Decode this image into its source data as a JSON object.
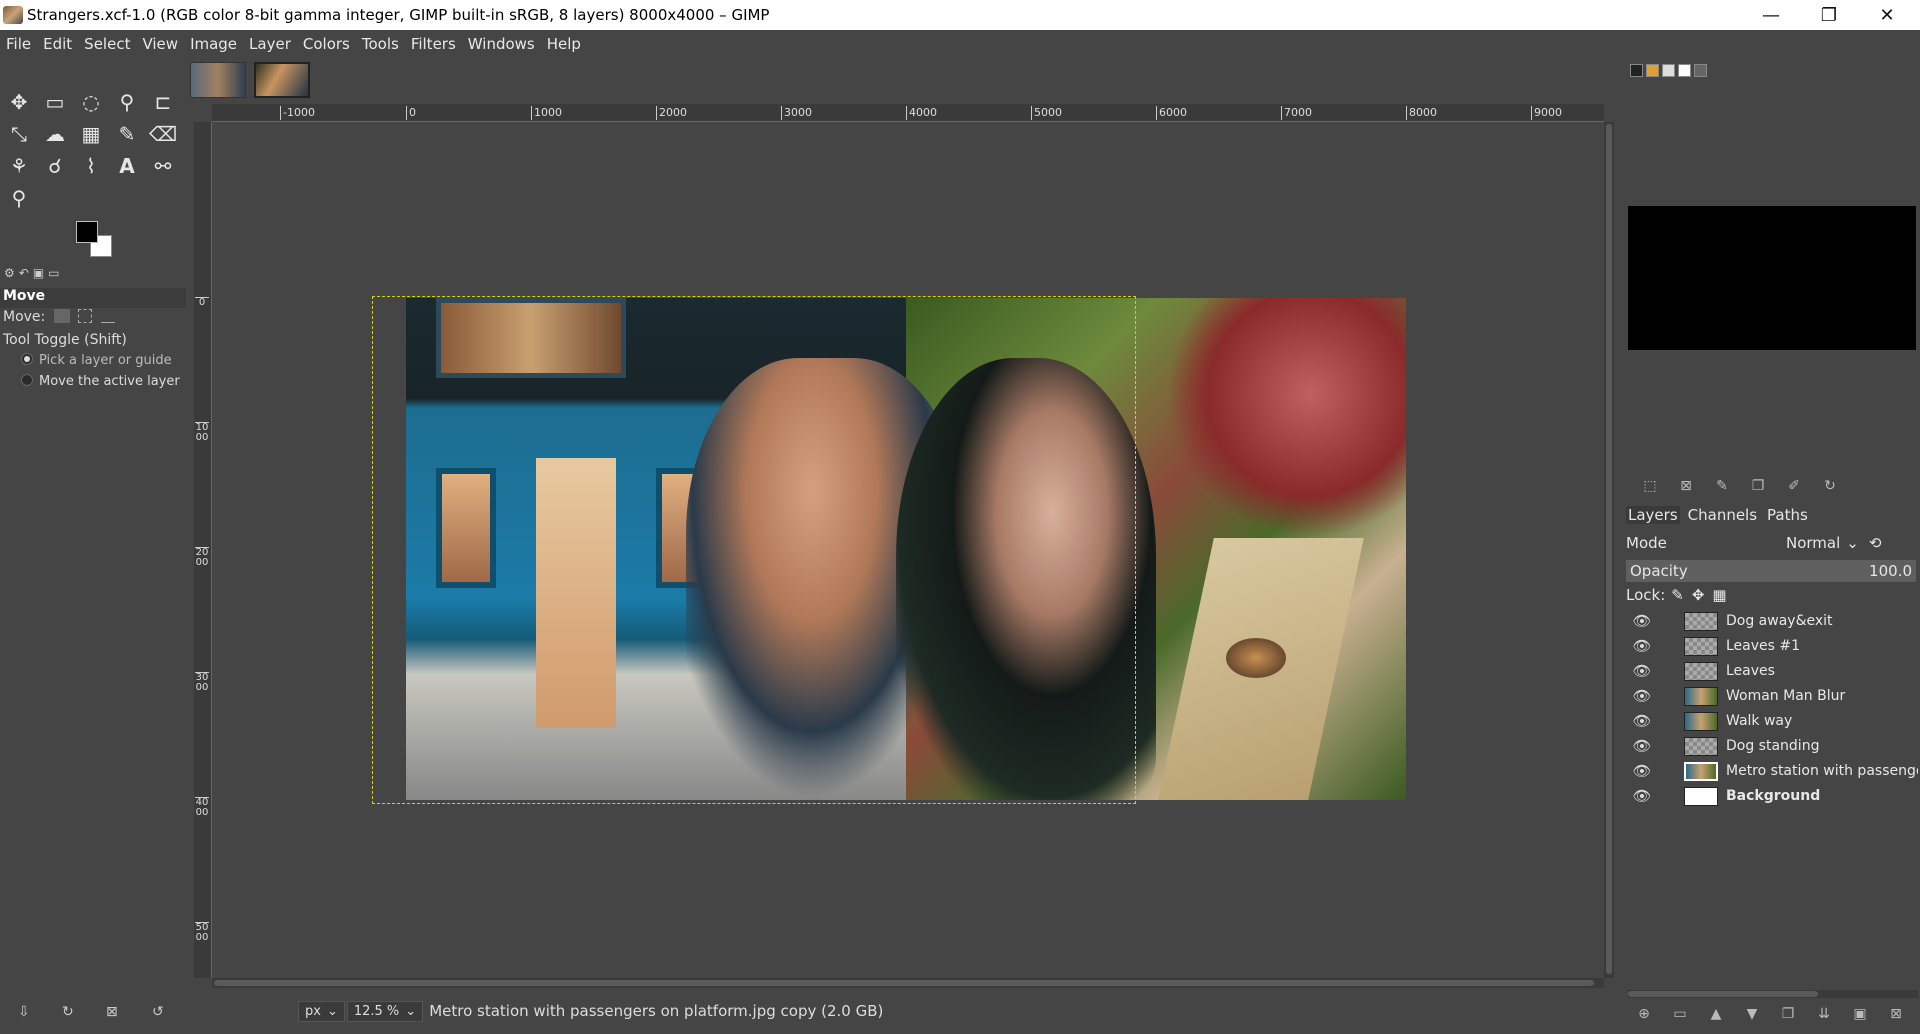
{
  "window": {
    "title": "Strangers.xcf-1.0 (RGB color 8-bit gamma integer, GIMP built-in sRGB, 8 layers) 8000x4000 – GIMP",
    "minimize_glyph": "—",
    "restore_glyph": "❐",
    "close_glyph": "✕"
  },
  "menu": [
    "File",
    "Edit",
    "Select",
    "View",
    "Image",
    "Layer",
    "Colors",
    "Tools",
    "Filters",
    "Windows",
    "Help"
  ],
  "toolbox": {
    "tools": [
      {
        "name": "move-tool",
        "glyph": "✥"
      },
      {
        "name": "rect-select-tool",
        "glyph": "▭"
      },
      {
        "name": "free-select-tool",
        "glyph": "◌"
      },
      {
        "name": "fuzzy-select-tool",
        "glyph": "⚲"
      },
      {
        "name": "crop-tool",
        "glyph": "⊏"
      },
      {
        "name": "unified-transform-tool",
        "glyph": "⤡"
      },
      {
        "name": "warp-transform-tool",
        "glyph": "☁"
      },
      {
        "name": "gradient-tool",
        "glyph": "▦"
      },
      {
        "name": "paintbrush-tool",
        "glyph": "✎"
      },
      {
        "name": "eraser-tool",
        "glyph": "⌫"
      },
      {
        "name": "clone-tool",
        "glyph": "⚘"
      },
      {
        "name": "smudge-tool",
        "glyph": "☌"
      },
      {
        "name": "paths-tool",
        "glyph": "⌇"
      },
      {
        "name": "text-tool",
        "glyph": "A"
      },
      {
        "name": "color-picker-tool",
        "glyph": "⚯"
      },
      {
        "name": "zoom-tool",
        "glyph": "⚲"
      }
    ],
    "tab_glyphs": [
      "⚙",
      "↶",
      "▣",
      "▭"
    ],
    "options": {
      "title": "Move",
      "move_label": "Move:",
      "tool_toggle": "Tool Toggle  (Shift)",
      "radio_pick": "Pick a layer or guide",
      "radio_move": "Move the active layer"
    },
    "bottom_glyphs": [
      "⇩",
      "↻",
      "⊠",
      "↺"
    ],
    "fg_color": "#000000",
    "bg_color": "#ffffff"
  },
  "rulers": {
    "h_ticks": [
      "-1000",
      "0",
      "1000",
      "2000",
      "3000",
      "4000",
      "5000",
      "6000",
      "7000",
      "8000",
      "9000"
    ],
    "v_ticks": [
      "0",
      "1000",
      "2000",
      "3000",
      "4000",
      "5000"
    ]
  },
  "status": {
    "unit": "px",
    "zoom": "12.5 %",
    "message": "Metro station with passengers on platform.jpg copy (2.0 GB)"
  },
  "layers_panel": {
    "tabs": [
      "Layers",
      "Channels",
      "Paths"
    ],
    "mode_label": "Mode",
    "mode_value": "Normal",
    "opacity_label": "Opacity",
    "opacity_value": "100.0",
    "lock_label": "Lock:",
    "layers": [
      {
        "name": "Dog away&exit",
        "thumb": "checker",
        "selected": false,
        "bold": false
      },
      {
        "name": "Leaves #1",
        "thumb": "checker",
        "selected": false,
        "bold": false
      },
      {
        "name": "Leaves",
        "thumb": "checker",
        "selected": false,
        "bold": false
      },
      {
        "name": "Woman Man Blur",
        "thumb": "photo",
        "selected": false,
        "bold": false
      },
      {
        "name": "Walk way",
        "thumb": "photo",
        "selected": false,
        "bold": false
      },
      {
        "name": "Dog standing",
        "thumb": "checker",
        "selected": false,
        "bold": false
      },
      {
        "name": "Metro station with passengers on platform.jpg copy",
        "thumb": "photo",
        "selected": true,
        "bold": false
      },
      {
        "name": "Background",
        "thumb": "white",
        "selected": false,
        "bold": true
      }
    ],
    "bottom_glyphs": [
      "⊕",
      "▭",
      "▲",
      "▼",
      "❐",
      "⇊",
      "▣",
      "⊠"
    ]
  }
}
